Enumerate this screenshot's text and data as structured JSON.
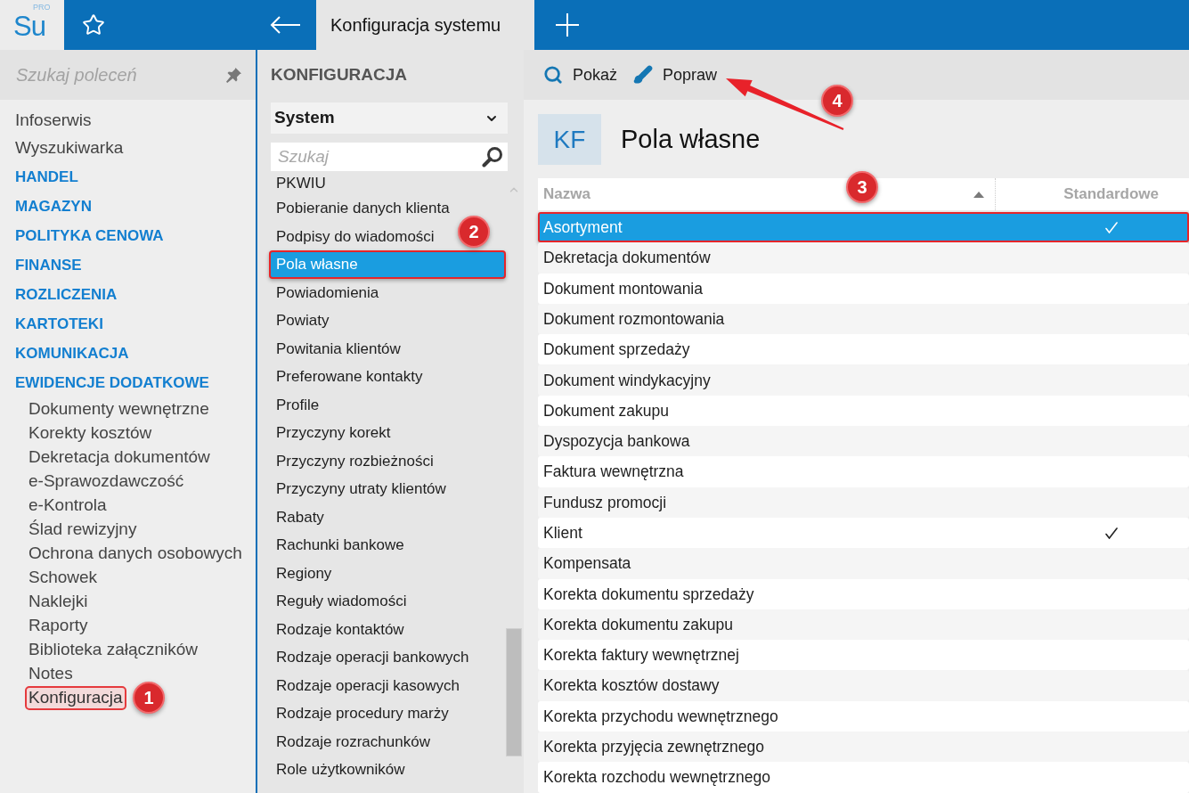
{
  "app_bar": {
    "logo": {
      "text": "Su",
      "superscript": "PRO"
    },
    "tab": {
      "title": "Konfiguracja systemu"
    }
  },
  "command_search": {
    "placeholder": "Szukaj poleceń"
  },
  "sidebar": {
    "items": [
      {
        "kind": "link",
        "label": "Infoserwis"
      },
      {
        "kind": "link",
        "label": "Wyszukiwarka"
      },
      {
        "kind": "section",
        "label": "HANDEL"
      },
      {
        "kind": "section",
        "label": "MAGAZYN"
      },
      {
        "kind": "section",
        "label": "POLITYKA CENOWA"
      },
      {
        "kind": "section",
        "label": "FINANSE"
      },
      {
        "kind": "section",
        "label": "ROZLICZENIA"
      },
      {
        "kind": "section",
        "label": "KARTOTEKI"
      },
      {
        "kind": "section",
        "label": "KOMUNIKACJA"
      },
      {
        "kind": "section",
        "label": "EWIDENCJE DODATKOWE",
        "children": [
          {
            "label": "Dokumenty wewnętrzne",
            "selected": false
          },
          {
            "label": "Korekty kosztów",
            "selected": false
          },
          {
            "label": "Dekretacja dokumentów",
            "selected": false
          },
          {
            "label": "e-Sprawozdawczość",
            "selected": false
          },
          {
            "label": "e-Kontrola",
            "selected": false
          },
          {
            "label": "Ślad rewizyjny",
            "selected": false
          },
          {
            "label": "Ochrona danych osobowych",
            "selected": false
          },
          {
            "label": "Schowek",
            "selected": false
          },
          {
            "label": "Naklejki",
            "selected": false
          },
          {
            "label": "Raporty",
            "selected": false
          },
          {
            "label": "Biblioteka załączników",
            "selected": false
          },
          {
            "label": "Notes",
            "selected": false
          },
          {
            "label": "Konfiguracja",
            "selected": true
          }
        ]
      }
    ]
  },
  "config_panel": {
    "title": "KONFIGURACJA",
    "dropdown": {
      "value": "System"
    },
    "search": {
      "placeholder": "Szukaj"
    },
    "items": [
      {
        "label": "PKWIU",
        "selected": false
      },
      {
        "label": "Pobieranie danych klienta",
        "selected": false
      },
      {
        "label": "Podpisy do wiadomości",
        "selected": false
      },
      {
        "label": "Pola własne",
        "selected": true
      },
      {
        "label": "Powiadomienia",
        "selected": false
      },
      {
        "label": "Powiaty",
        "selected": false
      },
      {
        "label": "Powitania klientów",
        "selected": false
      },
      {
        "label": "Preferowane kontakty",
        "selected": false
      },
      {
        "label": "Profile",
        "selected": false
      },
      {
        "label": "Przyczyny korekt",
        "selected": false
      },
      {
        "label": "Przyczyny rozbieżności",
        "selected": false
      },
      {
        "label": "Przyczyny utraty klientów",
        "selected": false
      },
      {
        "label": "Rabaty",
        "selected": false
      },
      {
        "label": "Rachunki bankowe",
        "selected": false
      },
      {
        "label": "Regiony",
        "selected": false
      },
      {
        "label": "Reguły wiadomości",
        "selected": false
      },
      {
        "label": "Rodzaje kontaktów",
        "selected": false
      },
      {
        "label": "Rodzaje operacji bankowych",
        "selected": false
      },
      {
        "label": "Rodzaje operacji kasowych",
        "selected": false
      },
      {
        "label": "Rodzaje procedury marży",
        "selected": false
      },
      {
        "label": "Rodzaje rozrachunków",
        "selected": false
      },
      {
        "label": "Role użytkowników",
        "selected": false
      }
    ]
  },
  "toolbar": {
    "buttons": [
      {
        "kind": "view",
        "label": "Pokaż"
      },
      {
        "kind": "edit",
        "label": "Popraw"
      }
    ]
  },
  "content": {
    "badge": "KF",
    "title": "Pola własne",
    "table": {
      "columns": [
        {
          "label": "Nazwa",
          "sorted": true
        },
        {
          "label": "Standardowe",
          "sorted": false
        }
      ],
      "rows": [
        {
          "name": "Asortyment",
          "standard": true,
          "selected": true
        },
        {
          "name": "Dekretacja dokumentów",
          "standard": false,
          "selected": false
        },
        {
          "name": "Dokument montowania",
          "standard": false,
          "selected": false
        },
        {
          "name": "Dokument rozmontowania",
          "standard": false,
          "selected": false
        },
        {
          "name": "Dokument sprzedaży",
          "standard": false,
          "selected": false
        },
        {
          "name": "Dokument windykacyjny",
          "standard": false,
          "selected": false
        },
        {
          "name": "Dokument zakupu",
          "standard": false,
          "selected": false
        },
        {
          "name": "Dyspozycja bankowa",
          "standard": false,
          "selected": false
        },
        {
          "name": "Faktura wewnętrzna",
          "standard": false,
          "selected": false
        },
        {
          "name": "Fundusz promocji",
          "standard": false,
          "selected": false
        },
        {
          "name": "Klient",
          "standard": true,
          "selected": false
        },
        {
          "name": "Kompensata",
          "standard": false,
          "selected": false
        },
        {
          "name": "Korekta dokumentu sprzedaży",
          "standard": false,
          "selected": false
        },
        {
          "name": "Korekta dokumentu zakupu",
          "standard": false,
          "selected": false
        },
        {
          "name": "Korekta faktury wewnętrznej",
          "standard": false,
          "selected": false
        },
        {
          "name": "Korekta kosztów dostawy",
          "standard": false,
          "selected": false
        },
        {
          "name": "Korekta przychodu wewnętrznego",
          "standard": false,
          "selected": false
        },
        {
          "name": "Korekta przyjęcia zewnętrznego",
          "standard": false,
          "selected": false
        },
        {
          "name": "Korekta rozchodu wewnętrznego",
          "standard": false,
          "selected": false
        }
      ]
    }
  },
  "annotations": [
    {
      "label": "1"
    },
    {
      "label": "2"
    },
    {
      "label": "3"
    },
    {
      "label": "4"
    }
  ]
}
